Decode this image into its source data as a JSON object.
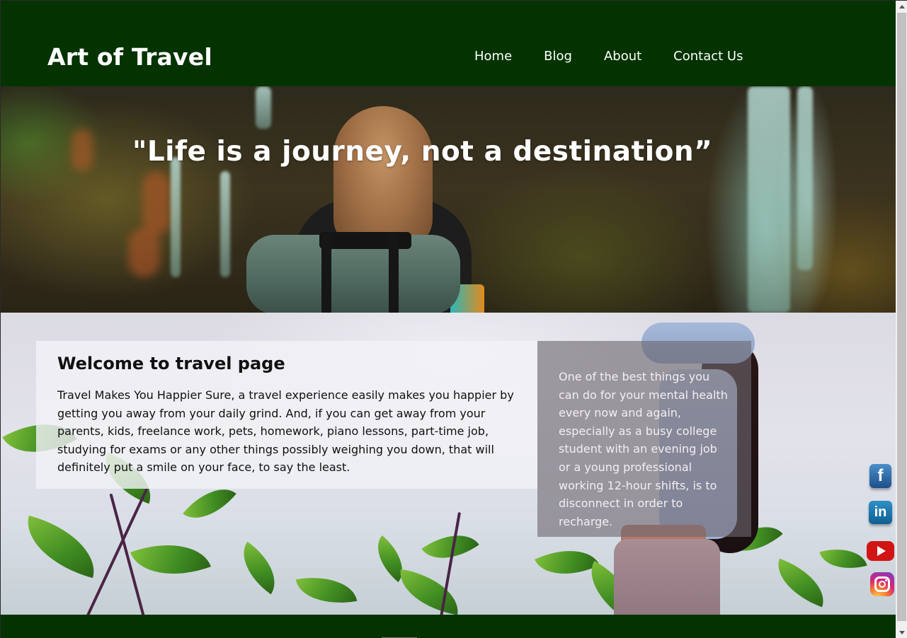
{
  "header": {
    "brand": "Art of Travel",
    "nav": [
      "Home",
      "Blog",
      "About",
      "Contact Us"
    ]
  },
  "hero": {
    "quote": "\"Life is a journey, not a destination”"
  },
  "welcome": {
    "title": "Welcome to travel page",
    "text": "Travel Makes You Happier Sure, a travel experience easily makes you happier by getting you away from your daily grind. And, if you can get away from your parents, kids, freelance work, pets, homework, piano lessons, part-time job, studying for exams or any other things possibly weighing you down, that will definitely put a smile on your face, to say the least."
  },
  "side": {
    "text": "One of the best things you can do for your mental health every now and again, especially as a busy college student with an evening job or a young professional working 12-hour shifts, is to disconnect in order to recharge."
  },
  "social": {
    "facebook_glyph": "f",
    "linkedin_glyph": "in",
    "icons": [
      "facebook-icon",
      "linkedin-icon",
      "youtube-icon",
      "instagram-icon"
    ]
  },
  "colors": {
    "header_bg": "#043300",
    "text_light": "#ffffff"
  }
}
